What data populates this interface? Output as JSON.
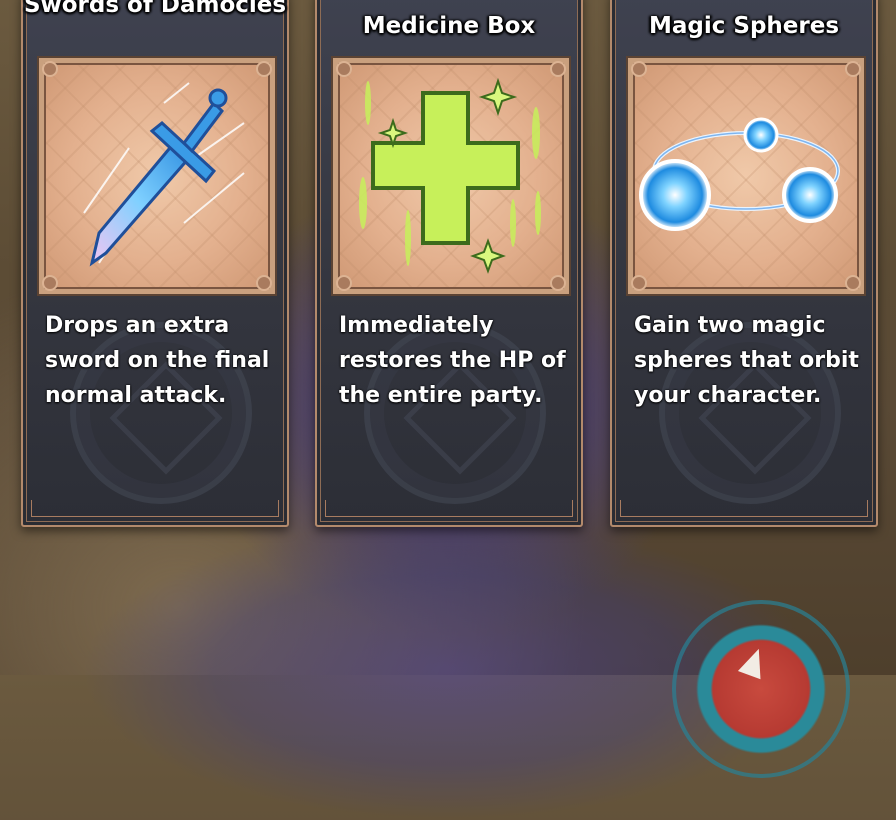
{
  "cards": [
    {
      "title": "Swords of Damocles",
      "icon": "sword-icon",
      "description": "Drops an extra sword on the final normal attack."
    },
    {
      "title": "Medicine Box",
      "icon": "green-cross-icon",
      "description": "Immediately restores the HP of the entire party."
    },
    {
      "title": "Magic Spheres",
      "icon": "magic-spheres-icon",
      "description": "Gain two magic spheres that orbit your character."
    }
  ],
  "colors": {
    "card_bg": "#383a44",
    "card_border": "#b38a6c",
    "frame_bg": "#e3b08e",
    "cross_green": "#c7f05a",
    "sphere_blue": "#4fb8ff"
  }
}
